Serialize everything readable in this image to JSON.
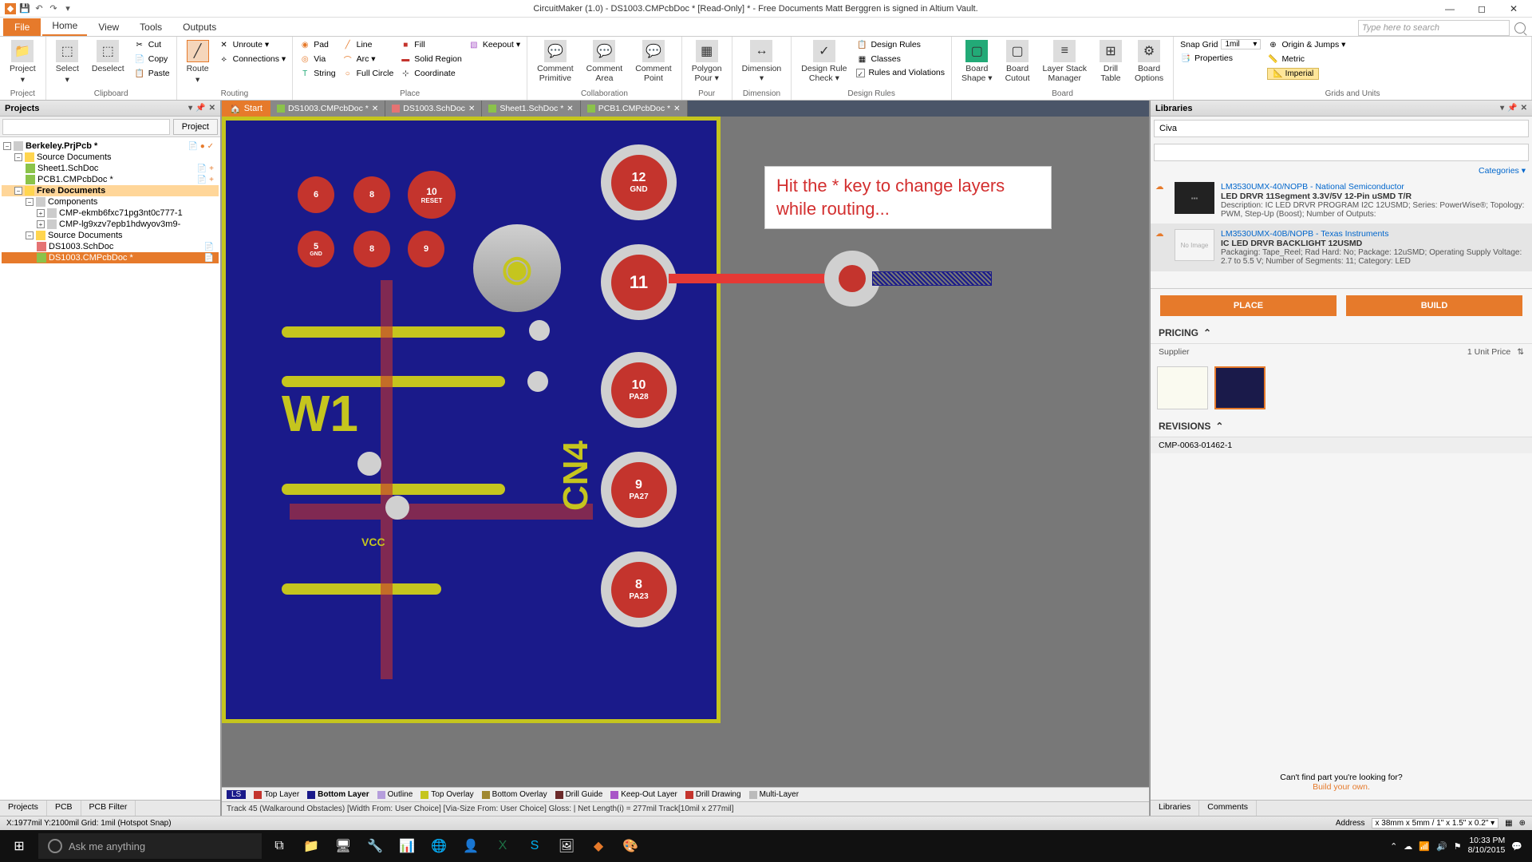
{
  "titlebar": {
    "title": "CircuitMaker (1.0) - DS1003.CMPcbDoc * [Read-Only] * - Free Documents Matt Berggren is signed in Altium Vault."
  },
  "ribbon_tabs": {
    "file": "File",
    "tabs": [
      "Home",
      "View",
      "Tools",
      "Outputs"
    ],
    "active": "Home",
    "search_placeholder": "Type here to search"
  },
  "ribbon": {
    "project": {
      "label": "Project",
      "btn": "Project"
    },
    "clipboard": {
      "label": "Clipboard",
      "select": "Select",
      "deselect": "Deselect",
      "cut": "Cut",
      "copy": "Copy",
      "paste": "Paste"
    },
    "routing": {
      "label": "Routing",
      "route": "Route",
      "unroute": "Unroute ▾",
      "connections": "Connections ▾"
    },
    "place": {
      "label": "Place",
      "pad": "Pad",
      "via": "Via",
      "string": "String",
      "line": "Line",
      "arc": "Arc ▾",
      "full_circle": "Full Circle",
      "fill": "Fill",
      "solid_region": "Solid Region",
      "keepout": "Keepout ▾",
      "coordinate": "Coordinate"
    },
    "collaboration": {
      "label": "Collaboration",
      "primitive": "Comment\nPrimitive",
      "area": "Comment\nArea",
      "point": "Comment\nPoint"
    },
    "pour": {
      "label": "Pour",
      "polygon": "Polygon\nPour ▾"
    },
    "dimension": {
      "label": "Dimension",
      "dimension": "Dimension\n▾"
    },
    "design_rules": {
      "label": "Design Rules",
      "check": "Design Rule\nCheck ▾",
      "rules": "Design Rules",
      "classes": "Classes",
      "violations": "Rules and Violations"
    },
    "board": {
      "label": "Board",
      "shape": "Board\nShape ▾",
      "cutout": "Board\nCutout",
      "stack": "Layer Stack\nManager",
      "drill": "Drill\nTable",
      "options": "Board\nOptions"
    },
    "grids": {
      "label": "Grids and Units",
      "snap_grid": "Snap Grid",
      "snap_value": "1mil",
      "origin": "Origin & Jumps ▾",
      "metric": "Metric",
      "imperial": "Imperial",
      "properties": "Properties"
    }
  },
  "projects_panel": {
    "title": "Projects",
    "btn": "Project",
    "tree": {
      "root": "Berkeley.PrjPcb *",
      "source_docs": "Source Documents",
      "sheet1": "Sheet1.SchDoc",
      "pcb1": "PCB1.CMPcbDoc *",
      "free_docs": "Free Documents",
      "components": "Components",
      "cmp1": "CMP-ekmb6fxc71pg3nt0c777-1",
      "cmp2": "CMP-lg9xzv7epb1hdwyov3m9-",
      "source_docs2": "Source Documents",
      "ds_sch": "DS1003.SchDoc",
      "ds_pcb": "DS1003.CMPcbDoc *"
    },
    "tabs": [
      "Projects",
      "PCB",
      "PCB Filter"
    ]
  },
  "doc_tabs": {
    "start": "Start",
    "tabs": [
      "DS1003.CMPcbDoc *",
      "DS1003.SchDoc",
      "Sheet1.SchDoc *",
      "PCB1.CMPcbDoc *"
    ]
  },
  "canvas": {
    "hint": "Hit the * key to change layers while routing...",
    "pads": {
      "p12": {
        "num": "12",
        "label": "GND"
      },
      "p11": {
        "num": "11",
        "label": ""
      },
      "p10": {
        "num": "10",
        "label": "PA28"
      },
      "p9": {
        "num": "9",
        "label": "PA27"
      },
      "p8": {
        "num": "8",
        "label": "PA23"
      },
      "p6": "6",
      "p7": "8",
      "p_reset": {
        "num": "10",
        "label": "RESET"
      },
      "p5": {
        "num": "5",
        "label": "GND"
      },
      "pp8": "8",
      "pp9": "9"
    },
    "silk": {
      "w1": "W1",
      "vcc": "VCC",
      "cn4": "CN4"
    }
  },
  "layers": {
    "ls": "LS",
    "items": [
      {
        "color": "#c4342d",
        "name": "Top Layer"
      },
      {
        "color": "#1a1a8a",
        "name": "Bottom Layer",
        "bold": true
      },
      {
        "color": "#b59edc",
        "name": "Outline"
      },
      {
        "color": "#c5c51e",
        "name": "Top Overlay"
      },
      {
        "color": "#a08830",
        "name": "Bottom Overlay"
      },
      {
        "color": "#6b2a2a",
        "name": "Drill Guide"
      },
      {
        "color": "#a855c7",
        "name": "Keep-Out Layer"
      },
      {
        "color": "#c4342d",
        "name": "Drill Drawing"
      },
      {
        "color": "#bbb",
        "name": "Multi-Layer"
      }
    ]
  },
  "status_inner": "Track 45 (Walkaround Obstacles) [Width From: User Choice] [Via-Size From: User Choice] Gloss: | Net Length(i) = 277mil  Track[10mil x 277mil]",
  "libraries_panel": {
    "title": "Libraries",
    "search_value": "Civa",
    "categories": "Categories ▾",
    "results": [
      {
        "title": "LM3530UMX-40/NOPB - National Semiconductor",
        "sub": "LED DRVR 11Segment 3.3V/5V 12-Pin uSMD T/R",
        "desc": "Description: IC LED DRVR PROGRAM I2C 12USMD; Series: PowerWise®; Topology: PWM, Step-Up (Boost); Number of Outputs:"
      },
      {
        "title": "LM3530UMX-40B/NOPB - Texas Instruments",
        "sub": "IC LED DRVR BACKLIGHT 12USMD",
        "desc": "Packaging: Tape_Reel; Rad Hard: No; Package: 12uSMD; Operating Supply Voltage: 2.7 to 5.5 V; Number of Segments: 11; Category: LED",
        "noimage": "No Image"
      }
    ],
    "place": "PLACE",
    "build": "BUILD",
    "pricing": "PRICING",
    "supplier": "Supplier",
    "unit_price": "1  Unit Price",
    "revisions": "REVISIONS",
    "revision_row": "CMP-0063-01462-1",
    "footer1": "Can't find part you're looking for?",
    "footer2": "Build your own.",
    "tabs": [
      "Libraries",
      "Comments"
    ]
  },
  "status_bar": {
    "left": "X:1977mil Y:2100mil   Grid: 1mil      (Hotspot Snap)",
    "address": "Address",
    "dims": "x 38mm x 5mm / 1\" x 1.5\" x 0.2\""
  },
  "taskbar": {
    "cortana": "Ask me anything",
    "time": "10:33 PM",
    "date": "8/10/2015"
  }
}
